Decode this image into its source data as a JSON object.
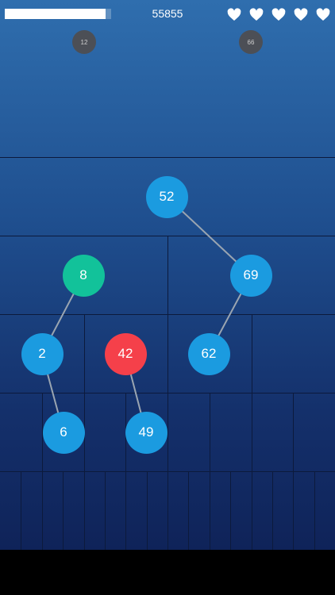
{
  "hud": {
    "progress": 0.95,
    "score": "55855",
    "lives": 5
  },
  "incoming": [
    {
      "label": "12"
    },
    {
      "label": "66"
    }
  ],
  "tree": {
    "nodes": [
      {
        "label": "52",
        "color": "#1b9be0",
        "kind": "normal"
      },
      {
        "label": "8",
        "color": "#12c29a",
        "kind": "highlighted"
      },
      {
        "label": "69",
        "color": "#1b9be0",
        "kind": "normal"
      },
      {
        "label": "2",
        "color": "#1b9be0",
        "kind": "normal"
      },
      {
        "label": "42",
        "color": "#f5404a",
        "kind": "selected"
      },
      {
        "label": "62",
        "color": "#1b9be0",
        "kind": "normal"
      },
      {
        "label": "6",
        "color": "#1b9be0",
        "kind": "normal"
      },
      {
        "label": "49",
        "color": "#1b9be0",
        "kind": "normal"
      }
    ],
    "edges": [
      [
        "52",
        "69"
      ],
      [
        "8",
        "2"
      ],
      [
        "69",
        "62"
      ],
      [
        "2",
        "6"
      ],
      [
        "42",
        "49"
      ]
    ]
  },
  "colors": {
    "edge": "#9aa5b1",
    "heart": "#ffffff",
    "incoming": "#4c4f56"
  }
}
